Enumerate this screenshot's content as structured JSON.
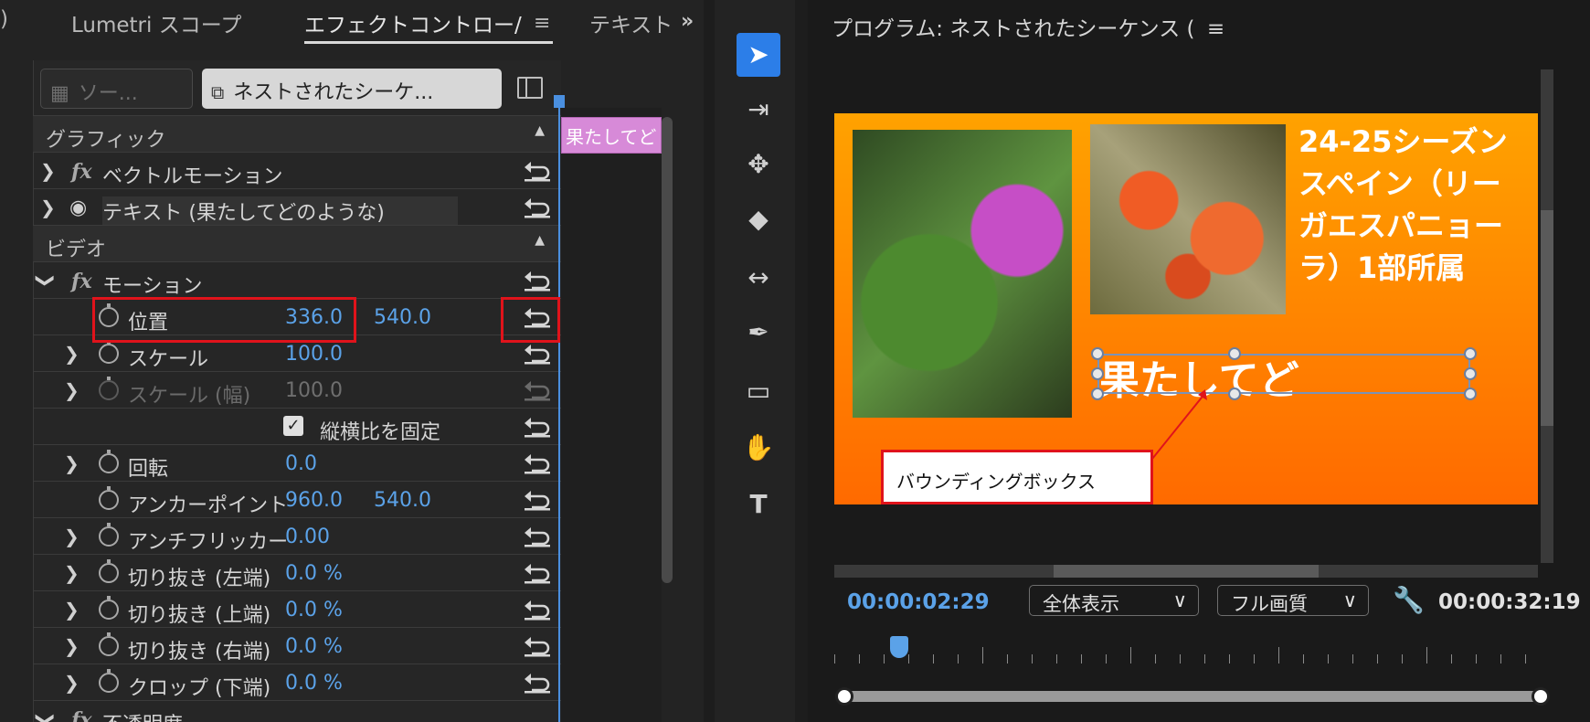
{
  "left_tabs": {
    "partial_tab": ")",
    "lumetri_scope": "Lumetri スコープ",
    "effect_controls": "エフェクトコントロー/",
    "text_tab": "テキスト",
    "menu_glyph": "≡",
    "overflow_glyph": "»"
  },
  "effect_controls": {
    "source_button": "ソー...",
    "sequence_button": "ネストされたシーケ...",
    "sections": {
      "graphics": "グラフィック",
      "video": "ビデオ"
    },
    "rows": {
      "vector_motion": "ベクトルモーション",
      "text_layer": "テキスト (果たしてどのような)",
      "motion": "モーション",
      "position_label": "位置",
      "position_x": "336.0",
      "position_y": "540.0",
      "scale_label": "スケール",
      "scale_value": "100.0",
      "scale_width_label": "スケール (幅)",
      "scale_width_value": "100.0",
      "uniform_scale_label": "縦横比を固定",
      "rotation_label": "回転",
      "rotation_value": "0.0",
      "anchor_label": "アンカーポイント",
      "anchor_x": "960.0",
      "anchor_y": "540.0",
      "antiflicker_label": "アンチフリッカー",
      "antiflicker_value": "0.00",
      "crop_left_label": "切り抜き (左端)",
      "crop_left_value": "0.0 %",
      "crop_top_label": "切り抜き (上端)",
      "crop_top_value": "0.0 %",
      "crop_right_label": "切り抜き (右端)",
      "crop_right_value": "0.0 %",
      "crop_bottom_label": "クロップ (下端)",
      "crop_bottom_value": "0.0 %",
      "opacity_label": "不透明度"
    },
    "fx_glyph": "fx",
    "clip_label": "果たしてど"
  },
  "program": {
    "title": "プログラム: ネストされたシーケンス (",
    "menu_glyph": "≡",
    "headline_lines": [
      "24-25シーズン",
      "スペイン（リー",
      "ガエスパニョー",
      "ラ）1部所属"
    ],
    "bounding_text": "果たしてど",
    "callout": "バウンディングボックス",
    "current_timecode": "00:00:02:29",
    "fit_dropdown": "全体表示",
    "quality_dropdown": "フル画質",
    "duration_timecode": "00:00:32:19",
    "dropdown_chevron": "∨"
  },
  "icons": {
    "tools": [
      "selection-tool-icon",
      "track-select-forward-icon",
      "ripple-edit-icon",
      "razor-icon",
      "slip-icon",
      "pen-icon",
      "rectangle-icon",
      "hand-icon",
      "type-icon"
    ]
  },
  "colors": {
    "accent_blue": "#2c7ee8",
    "value_blue": "#5ba2e8",
    "highlight_red": "#e0131b",
    "clip_pink": "#d78ad8",
    "video_orange_top": "#ffa200",
    "video_orange_bottom": "#ff6a00"
  }
}
